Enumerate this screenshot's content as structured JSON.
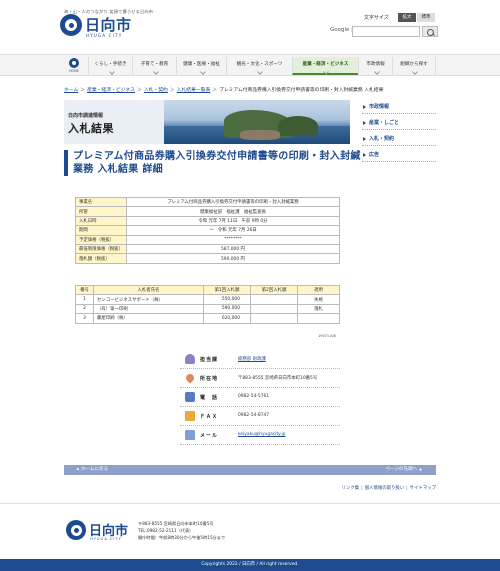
{
  "header": {
    "tagline": "海・山・人のつながり 笑顔で暮らせる日向市",
    "logo_text": "日向市",
    "logo_sub": "HYUGA CITY",
    "textsize_label": "文字サイズ",
    "textsize_large": "拡大",
    "textsize_standard": "標準",
    "search_brand": "Google",
    "search_brand_sub": "提供",
    "search_placeholder": ""
  },
  "nav": {
    "home_label": "HOME",
    "items": [
      {
        "label": "くらし・手続き"
      },
      {
        "label": "子育て・教育"
      },
      {
        "label": "健康・医療・福祉"
      },
      {
        "label": "観光・文化・スポーツ"
      },
      {
        "label": "産業・経済・ビジネス"
      },
      {
        "label": "市政情報"
      },
      {
        "label": "組織から探す"
      }
    ]
  },
  "breadcrumb": [
    "ホーム",
    "産業・経済・ビジネス",
    "入札・契約",
    "入札結果一覧表",
    "プレミアム付商品券購入引換券交付申請書等の印刷・封入封緘業務 入札結果"
  ],
  "banner": {
    "subtitle": "日向市調達情報",
    "title": "入札結果"
  },
  "sidenav": {
    "items": [
      "市政情報",
      "産業・しごと",
      "入札・契約",
      "広告"
    ]
  },
  "page_title": "プレミアム付商品券購入引換券交付申請書等の印刷・封入封緘業務 入札結果 詳細",
  "info_table": [
    {
      "label": "事業名",
      "value": "プレミアム付商品券購入引換券交付申請書等の印刷・封入封緘業務"
    },
    {
      "label": "所管",
      "value": "健康福祉部　福祉課　福祉監査係"
    },
    {
      "label": "入札日時",
      "value": "令和 元年 7月 11日　午前 9時 0分"
    },
    {
      "label": "期間",
      "value": "～　令和 元年 7月 26日"
    },
    {
      "label": "予定価格（税抜）",
      "value": "********"
    },
    {
      "label": "最低制限価格（税抜）",
      "value": "587,000 円"
    },
    {
      "label": "落札額（税抜）",
      "value": "590,000 円"
    }
  ],
  "bid_table": {
    "headers": [
      "番号",
      "入札者氏名",
      "第1回入札額",
      "第2回入札額",
      "適用"
    ],
    "rows": [
      {
        "no": "1",
        "name": "センコービジネスサポート（株）",
        "first": "550,000",
        "second": "",
        "note": "失格"
      },
      {
        "no": "2",
        "name": "（有）第一印刷",
        "first": "590,000",
        "second": "",
        "note": "落札"
      },
      {
        "no": "3",
        "name": "藤屋印刷（株）",
        "first": "620,000",
        "second": "",
        "note": ""
      }
    ],
    "id": "19071108"
  },
  "contact": {
    "dept_label": "担当課",
    "dept_value": "総務部 財政課",
    "addr_label": "所在地",
    "addr_value": "〒883-8555 宮崎県日向市本町10番5号",
    "tel_label": "電　話",
    "tel_value": "0982-54-5761",
    "fax_label": "ＦＡＸ",
    "fax_value": "0982-54-8747",
    "mail_label": "メール",
    "mail_value": "keiyaku@hyugacity.jp"
  },
  "pagebar": {
    "home": "ホームに戻る",
    "top": "ページの先頭へ"
  },
  "footlinks": [
    "リンク集",
    "個人情報の取り扱い",
    "サイトマップ"
  ],
  "footer": {
    "logo_text": "日向市",
    "logo_sub": "HYUGA CITY",
    "address": "〒883-8555 宮崎県日向市本町10番5号",
    "tel": "TEL:0982-52-2111（代表）",
    "hours": "開庁時間：午前8時30分から午後5時15分まで"
  },
  "copyright": "Copyrights 2022 / 日向市 / All right reserved."
}
